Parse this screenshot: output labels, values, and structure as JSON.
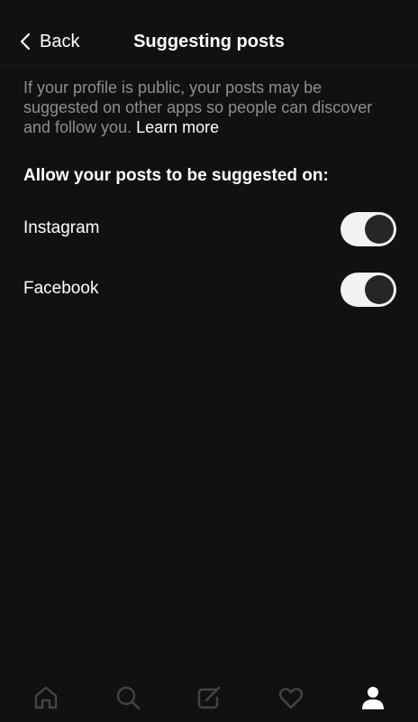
{
  "header": {
    "back_label": "Back",
    "title": "Suggesting posts"
  },
  "description": {
    "text": "If your profile is public, your posts may be suggested on other apps so people can discover and follow you.",
    "link_label": "Learn more"
  },
  "section": {
    "heading": "Allow your posts to be suggested on:"
  },
  "settings": [
    {
      "label": "Instagram",
      "enabled": true
    },
    {
      "label": "Facebook",
      "enabled": true
    }
  ],
  "tab_bar": {
    "tabs": [
      {
        "icon": "home-icon",
        "active": false
      },
      {
        "icon": "search-icon",
        "active": false
      },
      {
        "icon": "compose-icon",
        "active": false
      },
      {
        "icon": "heart-icon",
        "active": false
      },
      {
        "icon": "profile-icon",
        "active": true
      }
    ]
  },
  "colors": {
    "background": "#111111",
    "text_primary": "#ffffff",
    "text_secondary": "#8e8e8e",
    "toggle_track": "#f2f2f2",
    "toggle_knob": "#262626",
    "icon_inactive": "#444444"
  }
}
